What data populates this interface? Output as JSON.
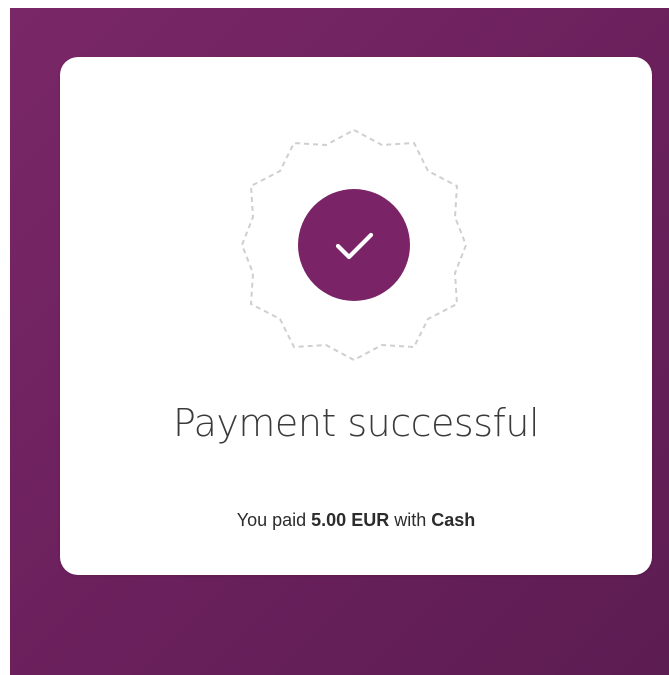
{
  "page": {
    "accent_color": "#7a2467",
    "background_color": "#6a205c"
  },
  "card": {
    "status_icon": "checkmark-icon",
    "badge_icon": "dashed-badge-icon",
    "title": "Payment successful",
    "details": {
      "prefix": "You paid",
      "amount": "5.00 EUR",
      "middle": "with",
      "method": "Cash"
    }
  }
}
